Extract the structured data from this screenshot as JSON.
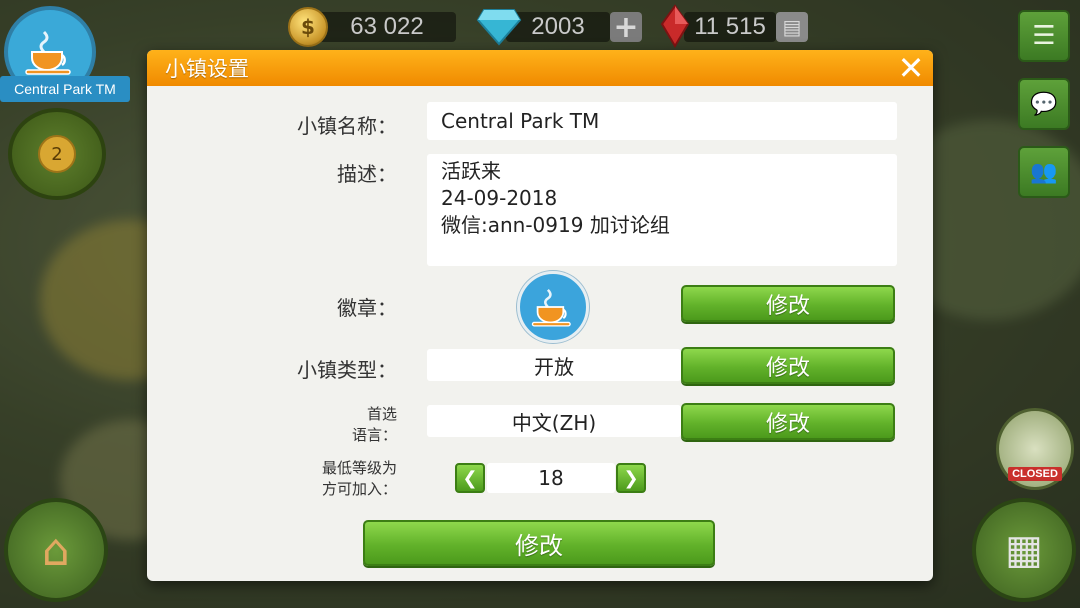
{
  "hud": {
    "coins": "63 022",
    "gems": "2003",
    "rubies": "11 515",
    "coin_symbol": "$",
    "gem_plus": "+"
  },
  "town_badge": {
    "name": "Central Park TM",
    "level": "2"
  },
  "closed_badge": "CLOSED",
  "dialog": {
    "title": "小镇设置",
    "close_symbol": "✕",
    "town_name_label": "小镇名称：",
    "town_name_value": "Central Park TM",
    "description_label": "描述：",
    "description_lines": [
      "活跃来",
      "24-09-2018",
      "微信:ann-0919 加讨论组"
    ],
    "emblem_label": "徽章：",
    "emblem_change": "修改",
    "town_type_label": "小镇类型：",
    "town_type_value": "开放",
    "town_type_change": "修改",
    "language_label_line1": "首选",
    "language_label_line2": "语言：",
    "language_value": "中文(ZH)",
    "language_change": "修改",
    "min_level_label_line1": "最低等级为",
    "min_level_label_line2": "方可加入：",
    "min_level_value": "18",
    "submit": "修改"
  },
  "icons": {
    "menu": "menu-list-icon",
    "chat": "chat-icon",
    "friends": "friends-icon",
    "cup": "coffee-cup-icon"
  },
  "colors": {
    "header": "#f5a000",
    "button_green": "#62b22a"
  }
}
